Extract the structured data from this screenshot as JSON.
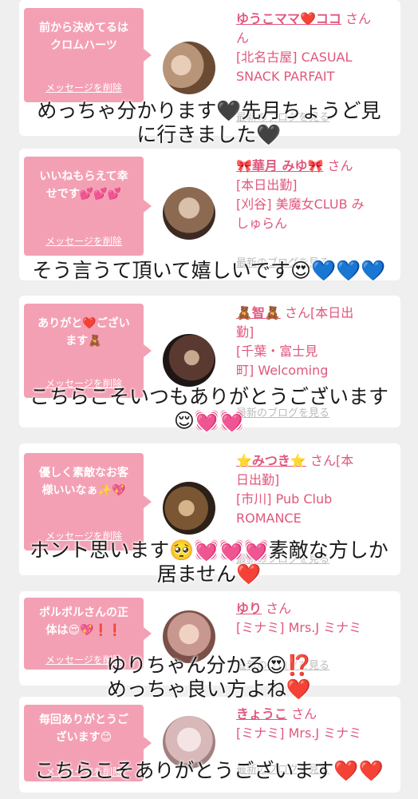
{
  "cards": [
    {
      "bubble": [
        "前から決めてるは",
        "クロムハーツ"
      ],
      "delete_label": "メッセージを削除",
      "name": "ゆうこママ❤️ココ",
      "san": "さん",
      "name_cont": "ん",
      "shop": [
        "[北名古屋] CASUAL",
        "SNACK PARFAIT"
      ],
      "blog_label": "最新のブログを見る"
    },
    {
      "bubble": [
        "いいねもらえて幸",
        "せです💕💕💕"
      ],
      "delete_label": "メッセージを削除",
      "name": "🎀華月 みゆ🎀",
      "san": "さん",
      "shop": [
        "[本日出勤]",
        "[刈谷] 美魔女CLUB み",
        "しゅらん"
      ],
      "blog_label": "最新のブログを見る"
    },
    {
      "bubble": [
        "ありがと❤️ござい",
        "ます🧸"
      ],
      "delete_label": "メッセージを削除",
      "name": "🧸智🧸",
      "san": "さん[本日出",
      "shop": [
        "勤]",
        "[千葉・富士見",
        "町] Welcoming"
      ],
      "blog_label": "最新のブログを見る"
    },
    {
      "bubble": [
        "優しく素敵なお客",
        "様いいなぁ✨💖"
      ],
      "delete_label": "メッセージを削除",
      "name": "⭐️みつき⭐️",
      "san": "さん[本",
      "shop": [
        "日出勤]",
        "[市川] Pub Club",
        "ROMANCE"
      ],
      "blog_label": "最新のブログを見る"
    },
    {
      "bubble": [
        "ポルポルさんの正",
        "体は😍💖❗️❗️"
      ],
      "delete_label": "メッセージを削除",
      "name": "ゆり",
      "san": "さん",
      "shop": [
        "[ミナミ] Mrs.J ミナミ"
      ],
      "blog_label": "最新のブログを見る"
    },
    {
      "bubble": [
        "毎回ありがとうご",
        "ざいます😊"
      ],
      "delete_label": "メッセージを削除",
      "name": "きょうこ",
      "san": "さん",
      "shop": [
        "[ミナミ] Mrs.J ミナミ"
      ],
      "blog_label": "最新のブログを見る"
    }
  ],
  "captions": [
    [
      "めっちゃ分かります🖤先月ちょうど見",
      "に行きました🖤"
    ],
    [
      "そう言うて頂いて嬉しいです😍💙💙💙"
    ],
    [
      "こちらこそいつもありがとうございます",
      "😌💓💓"
    ],
    [
      "ホント思います🥺💓💓💓素敵な方しか",
      "居ません❤️"
    ],
    [
      "ゆりちゃん分かる😍⁉️",
      "めっちゃ良い方よね❤️"
    ],
    [
      "こちらこそありがとうございます❤️❤️"
    ]
  ],
  "colors": {
    "accent": "#e0577c",
    "bubble": "#f4a0b4",
    "background": "#efefef"
  }
}
